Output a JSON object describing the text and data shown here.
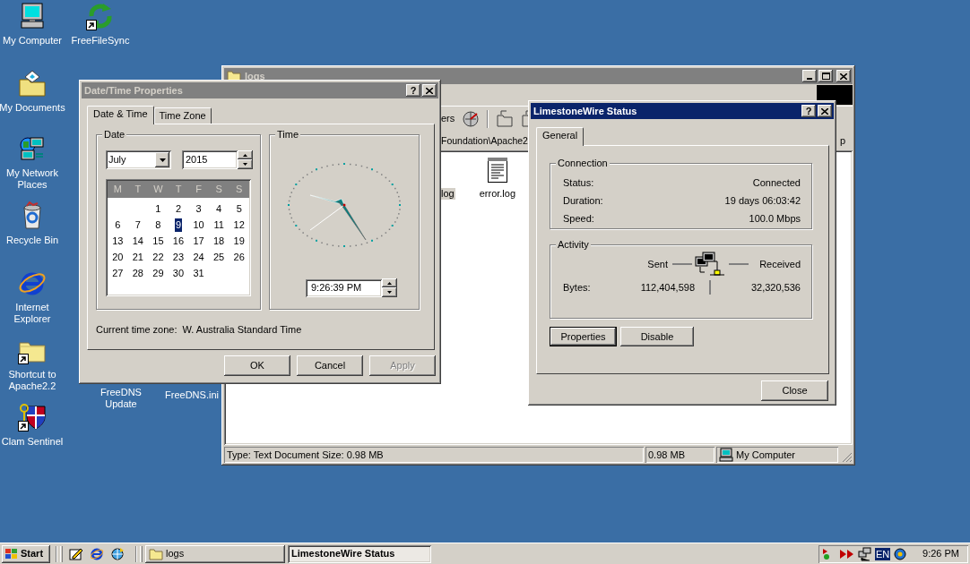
{
  "desktop_icons": [
    {
      "label": "My Computer",
      "kind": "computer",
      "shortcut": false
    },
    {
      "label": "FreeFileSync",
      "kind": "sync",
      "shortcut": true
    },
    {
      "label": "My Documents",
      "kind": "documents",
      "shortcut": false
    },
    {
      "label": "My Network Places",
      "kind": "network",
      "shortcut": false
    },
    {
      "label": "Recycle Bin",
      "kind": "recycle",
      "shortcut": false
    },
    {
      "label": "Internet Explorer",
      "kind": "browser",
      "shortcut": false
    },
    {
      "label": "Shortcut to Apache2.2",
      "kind": "folder",
      "shortcut": true
    },
    {
      "label": "Clam Sentinel",
      "kind": "shield",
      "shortcut": true
    },
    {
      "label": "FreeDNS Update",
      "kind": "covered"
    },
    {
      "label": "FreeDNS.ini",
      "kind": "covered"
    }
  ],
  "explorer": {
    "title": "logs",
    "active": false,
    "toolbar_label": "ers",
    "address": "Foundation\\Apache2",
    "address_end": "p",
    "files": [
      {
        "name": "log",
        "kind": "covered",
        "selected": true
      },
      {
        "name": "error.log",
        "kind": "text",
        "selected": false
      }
    ],
    "status_bar": [
      "Type: Text Document Size: 0.98 MB",
      "0.98 MB",
      "My Computer"
    ]
  },
  "datetime_dialog": {
    "title": "Date/Time Properties",
    "active": false,
    "help_button": "?",
    "tabs": [
      {
        "label": "Date & Time",
        "selected": true
      },
      {
        "label": "Time Zone",
        "selected": false
      }
    ],
    "date_group": "Date",
    "month": "July",
    "year": "2015",
    "weekdays": [
      "M",
      "T",
      "W",
      "T",
      "F",
      "S",
      "S"
    ],
    "weeks": [
      [
        {
          "day": "1",
          "selected": false
        },
        {
          "day": "2",
          "selected": false
        },
        {
          "day": "3",
          "selected": false
        },
        {
          "day": "4",
          "selected": false
        },
        {
          "day": "5",
          "selected": false
        }
      ],
      [
        {
          "day": "6",
          "selected": false
        },
        {
          "day": "7",
          "selected": false
        },
        {
          "day": "8",
          "selected": false
        },
        {
          "day": "9",
          "selected": true
        },
        {
          "day": "10",
          "selected": false
        },
        {
          "day": "11",
          "selected": false
        },
        {
          "day": "12",
          "selected": false
        }
      ],
      [
        {
          "day": "13",
          "selected": false
        },
        {
          "day": "14",
          "selected": false
        },
        {
          "day": "15",
          "selected": false
        },
        {
          "day": "16",
          "selected": false
        },
        {
          "day": "17",
          "selected": false
        },
        {
          "day": "18",
          "selected": false
        },
        {
          "day": "19",
          "selected": false
        }
      ],
      [
        {
          "day": "20",
          "selected": false
        },
        {
          "day": "21",
          "selected": false
        },
        {
          "day": "22",
          "selected": false
        },
        {
          "day": "23",
          "selected": false
        },
        {
          "day": "24",
          "selected": false
        },
        {
          "day": "25",
          "selected": false
        },
        {
          "day": "26",
          "selected": false
        }
      ],
      [
        {
          "day": "27",
          "selected": false
        },
        {
          "day": "28",
          "selected": false
        },
        {
          "day": "29",
          "selected": false
        },
        {
          "day": "30",
          "selected": false
        },
        {
          "day": "31",
          "selected": false
        }
      ]
    ],
    "time_group": "Time",
    "time": "9:26:39 PM",
    "time_zone_text": "Current time zone:  W. Australia Standard Time",
    "buttons": [
      {
        "label": "OK",
        "disabled": false
      },
      {
        "label": "Cancel",
        "disabled": false
      },
      {
        "label": "Apply",
        "disabled": true
      }
    ]
  },
  "status_dialog": {
    "title": "LimestoneWire Status",
    "active": true,
    "help_button": "?",
    "tabs": [
      {
        "label": "General",
        "selected": true
      }
    ],
    "connection_group": "Connection",
    "connection": [
      {
        "label": "Status:",
        "value": "Connected"
      },
      {
        "label": "Duration:",
        "value": "19 days 06:03:42"
      },
      {
        "label": "Speed:",
        "value": "100.0 Mbps"
      }
    ],
    "activity_group": "Activity",
    "sent_label": "Sent",
    "received_label": "Received",
    "bytes_label": "Bytes:",
    "bytes_sent": "112,404,598",
    "bytes_received": "32,320,536",
    "buttons": [
      {
        "label": "Properties",
        "default": true
      },
      {
        "label": "Disable",
        "default": false
      }
    ],
    "close_button": "Close"
  },
  "taskbar": {
    "start": "Start",
    "tasks": [
      {
        "label": "logs",
        "kind": "folder",
        "selected": false
      },
      {
        "label": "LimestoneWire Status",
        "kind": "plain",
        "selected": true
      }
    ],
    "language": "EN",
    "clock": "9:26 PM"
  }
}
